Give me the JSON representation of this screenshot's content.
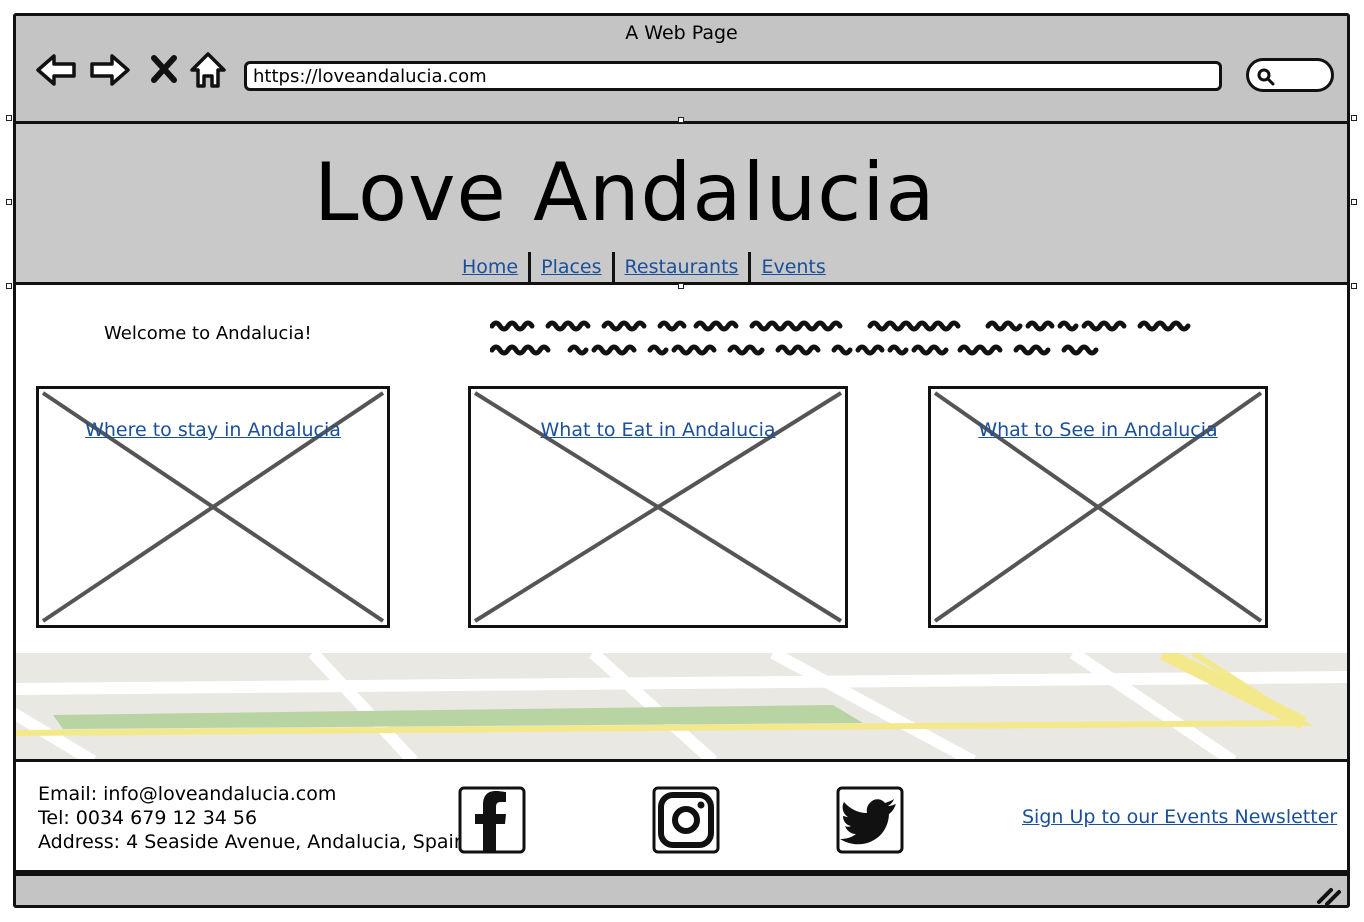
{
  "window": {
    "title": "A Web Page"
  },
  "browser": {
    "url": "https://loveandalucia.com"
  },
  "header": {
    "title": "Love Andalucia",
    "nav": [
      "Home",
      "Places",
      "Restaurants",
      "Events"
    ]
  },
  "intro": {
    "welcome": "Welcome to Andalucia!"
  },
  "cards": [
    {
      "label": "Where to stay in Andalucia"
    },
    {
      "label": "What to Eat in Andalucia"
    },
    {
      "label": "What to See in Andalucia"
    }
  ],
  "footer": {
    "email": "Email: info@loveandalucia.com",
    "tel": "Tel: 0034 679 12 34 56",
    "address": "Address: 4 Seaside Avenue, Andalucia, Spain",
    "social": [
      "facebook-icon",
      "instagram-icon",
      "twitter-icon"
    ],
    "newsletter": "Sign Up to our Events Newsletter"
  },
  "colors": {
    "chrome": "#c4c4c4",
    "link": "#1a4f9a",
    "placeholder_x": "#555555",
    "map_land": "#e9e8e2",
    "map_park": "#b9d4a3",
    "map_road": "#f4e98a"
  }
}
